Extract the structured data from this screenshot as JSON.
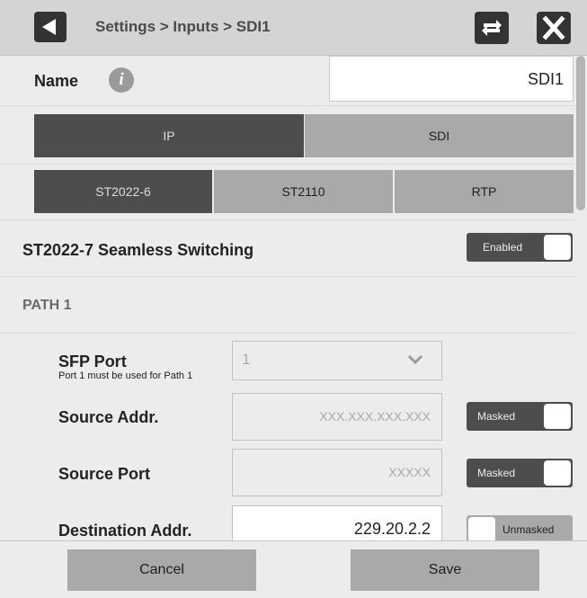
{
  "header": {
    "breadcrumb": "Settings > Inputs > SDI1"
  },
  "name": {
    "label": "Name",
    "value": "SDI1"
  },
  "input_tabs": [
    {
      "label": "IP",
      "active": true
    },
    {
      "label": "SDI",
      "active": false
    }
  ],
  "protocol_tabs": [
    {
      "label": "ST2022-6",
      "active": true
    },
    {
      "label": "ST2110",
      "active": false
    },
    {
      "label": "RTP",
      "active": false
    }
  ],
  "seamless": {
    "label": "ST2022-7 Seamless Switching",
    "toggle": "Enabled"
  },
  "path": {
    "label": "PATH 1",
    "sfp_label": "SFP Port",
    "sfp_note": "Port 1 must be used for Path 1",
    "sfp_value": "1",
    "source_addr_label": "Source Addr.",
    "source_addr_value": "XXX.XXX.XXX.XXX",
    "source_addr_toggle": "Masked",
    "source_port_label": "Source Port",
    "source_port_value": "XXXXX",
    "source_port_toggle": "Masked",
    "dest_addr_label": "Destination Addr.",
    "dest_addr_value": "229.20.2.2",
    "dest_addr_toggle": "Unmasked"
  },
  "footer": {
    "cancel": "Cancel",
    "save": "Save"
  },
  "icons": {
    "back": "back-arrow-icon",
    "swap": "swap-arrows-icon",
    "close": "close-x-icon",
    "info": "info-icon",
    "dropdown": "chevron-down-icon"
  },
  "colors": {
    "active_tab": "#4d4d4d",
    "inactive_tab": "#a9a9a9",
    "background": "#ececec",
    "header": "#d4d4d4"
  }
}
